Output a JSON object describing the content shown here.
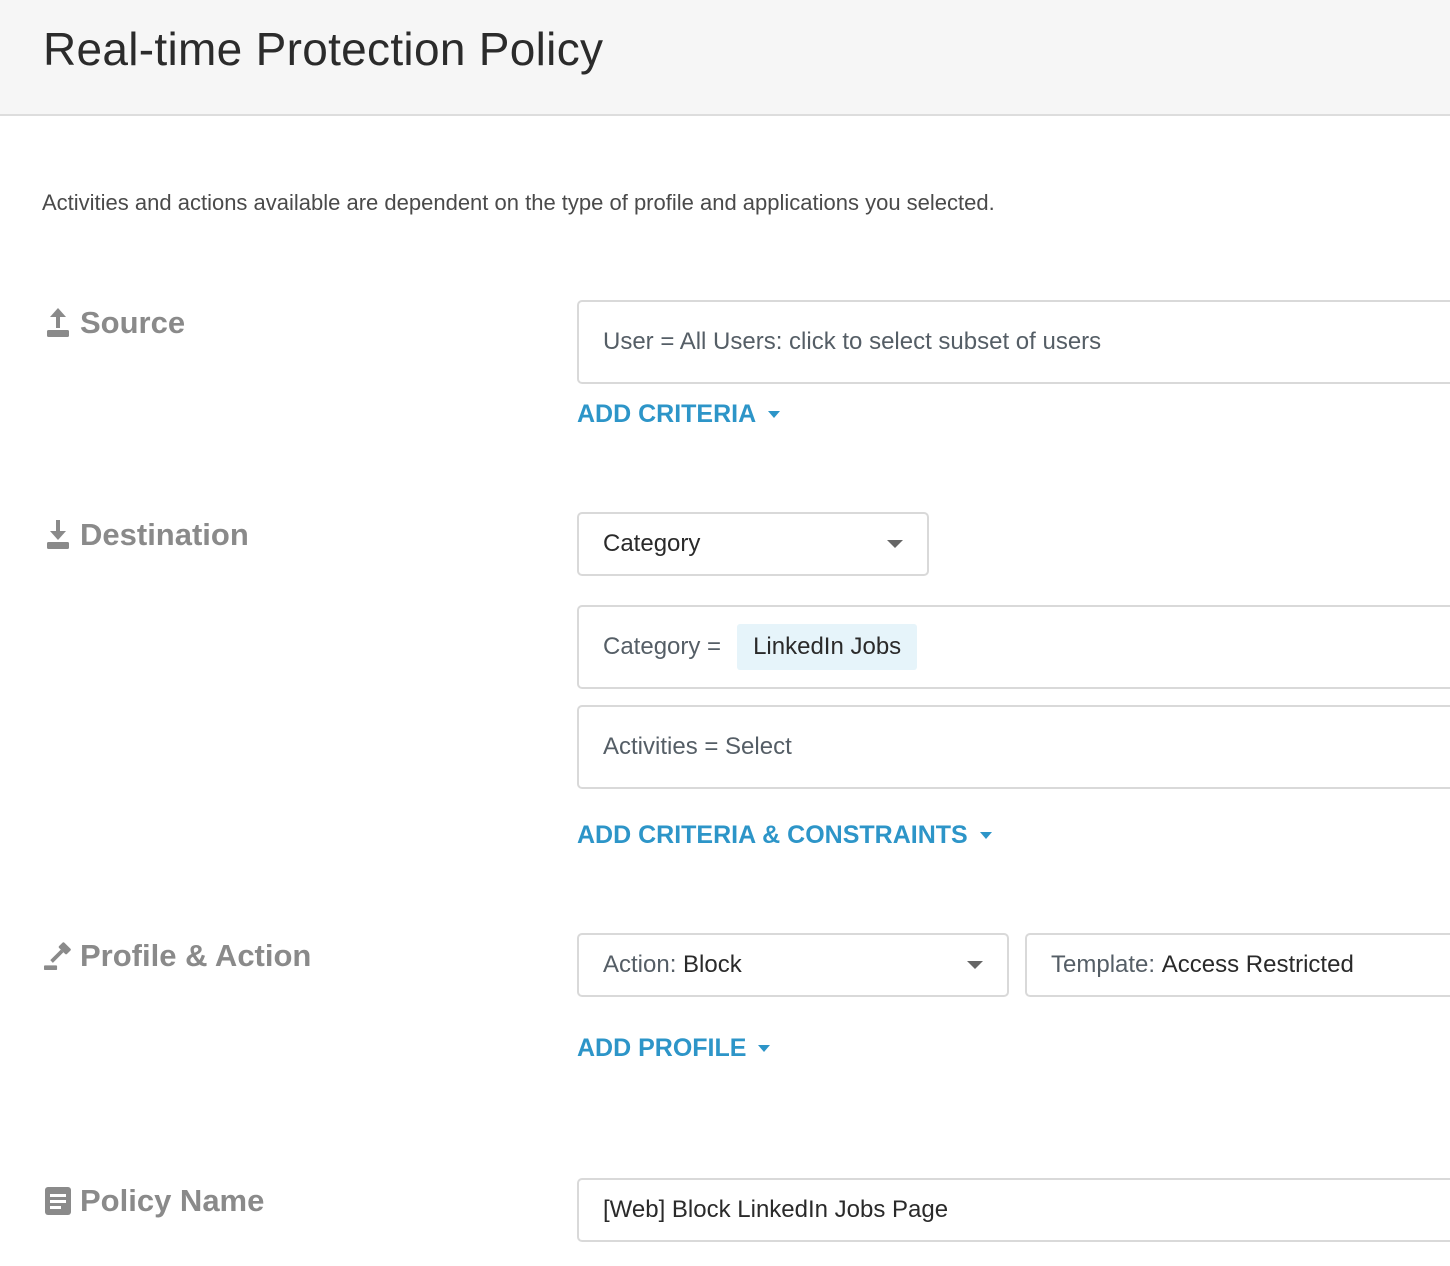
{
  "header": {
    "title": "Real-time Protection Policy"
  },
  "intro_text": "Activities and actions available are dependent on the type of profile and applications you selected.",
  "source": {
    "label": "Source",
    "icon": "upload-icon",
    "user_field": "User = All Users: click to select subset of users",
    "add_link": "ADD CRITERIA"
  },
  "destination": {
    "label": "Destination",
    "icon": "download-icon",
    "type_select": "Category",
    "category_prefix": "Category =",
    "category_chip": "LinkedIn Jobs",
    "activities_field": "Activities = Select",
    "add_link": "ADD CRITERIA & CONSTRAINTS"
  },
  "profile_action": {
    "label": "Profile & Action",
    "icon": "gavel-icon",
    "action_prefix": "Action:",
    "action_value": "Block",
    "template_prefix": "Template:",
    "template_value": "Access Restricted",
    "add_link": "ADD PROFILE"
  },
  "policy_name": {
    "label": "Policy Name",
    "icon": "document-icon",
    "value": "[Web] Block LinkedIn Jobs Page"
  },
  "colors": {
    "accent": "#2d95c8",
    "chip_bg": "#e6f4fa",
    "label_gray": "#8a8a8a",
    "header_bg": "#f6f6f6"
  }
}
